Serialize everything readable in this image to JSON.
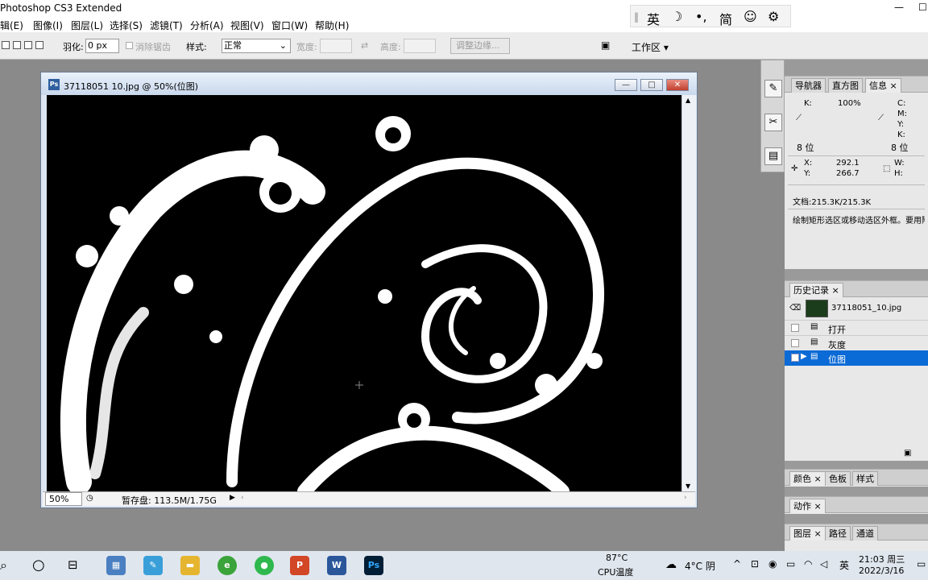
{
  "window": {
    "title": "Photoshop CS3 Extended",
    "date": "2022/3/16"
  },
  "menu": [
    "辑(E)",
    "图像(I)",
    "图层(L)",
    "选择(S)",
    "滤镜(T)",
    "分析(A)",
    "视图(V)",
    "窗口(W)",
    "帮助(H)"
  ],
  "ime": {
    "lang": "英",
    "moon": "☽",
    "punct": "•,",
    "simplified": "简",
    "smile": "☺",
    "gear": "⚙"
  },
  "options": {
    "feather_label": "羽化:",
    "feather_value": "0 px",
    "antialias_label": "消除锯齿",
    "style_label": "样式:",
    "style_value": "正常",
    "width_label": "宽度:",
    "height_label": "高度:",
    "refine_edge": "调整边缘...",
    "workspace": "工作区 ▾"
  },
  "document": {
    "title": "37118051 10.jpg @ 50%(位图)",
    "zoom": "50%",
    "scratch": "暂存盘: 113.5M/1.75G"
  },
  "info_panel": {
    "tabs": [
      "导航器",
      "直方图",
      "信息"
    ],
    "k_label": "K:",
    "k_value": "100%",
    "c_label": "C:",
    "m_label": "M:",
    "y_label": "Y:",
    "k2_label": "K:",
    "bits_left": "8 位",
    "bits_right": "8 位",
    "x_label": "X:",
    "x_value": "292.1",
    "y2_label": "Y:",
    "y_value": "266.7",
    "w_label": "W:",
    "h_label": "H:",
    "doc_size": "文档:215.3K/215.3K",
    "hint": "绘制矩形选区或移动选区外框。要用附加选项，使用 Shift、Alt 和 Ctrl 键。"
  },
  "history_panel": {
    "tab": "历史记录",
    "snapshot": "37118051_10.jpg",
    "items": [
      "打开",
      "灰度",
      "位图"
    ]
  },
  "color_panel": {
    "tabs": [
      "颜色",
      "色板",
      "样式"
    ]
  },
  "actions_panel": {
    "tab": "动作"
  },
  "layers_panel": {
    "tabs": [
      "图层",
      "路径",
      "通道"
    ]
  },
  "taskbar": {
    "temp_cpu": "87°C",
    "cpu_label": "CPU温度",
    "weather": "4°C 阴",
    "ime": "英",
    "time": "21:03 周三",
    "date": "2022/3/16",
    "ppt": "P",
    "word": "W",
    "ps": "Ps"
  },
  "colors": {
    "selection": "#0a6ad6",
    "doc_title": "#c9d8ec",
    "close": "#c0402f"
  }
}
